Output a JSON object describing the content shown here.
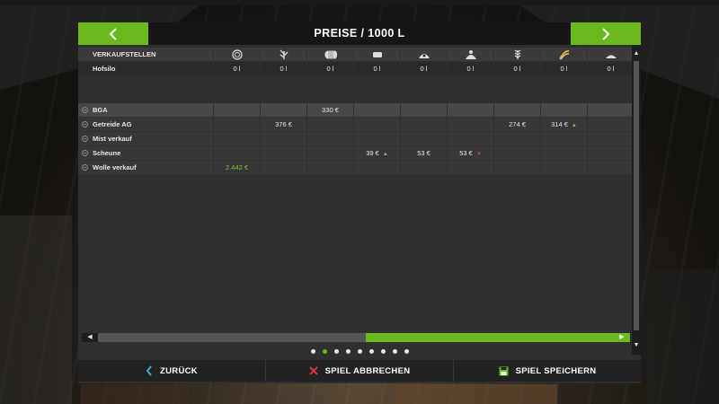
{
  "header": {
    "title": "PREISE / 1000 L"
  },
  "table": {
    "header_label": "VERKAUFSTELLEN",
    "product_icons": [
      "wool-icon",
      "grass-icon",
      "bale-icon",
      "block-icon",
      "heap-icon",
      "sack-icon",
      "wheat-icon",
      "straw-icon",
      "pile-icon"
    ],
    "silo_label": "Hofsilo",
    "silo_values": [
      "0 l",
      "0 l",
      "0 l",
      "0 l",
      "0 l",
      "0 l",
      "0 l",
      "0 l",
      "0 l"
    ],
    "rows": [
      {
        "name": "BGA",
        "cells": [
          "",
          "",
          "330 €",
          "",
          "",
          "",
          "",
          "",
          ""
        ]
      },
      {
        "name": "Getreide AG",
        "cells": [
          "",
          "376 €",
          "",
          "",
          "",
          "",
          "274 €",
          "314 €",
          ""
        ]
      },
      {
        "name": "Mist verkauf",
        "cells": [
          "",
          "",
          "",
          "",
          "",
          "",
          "",
          "",
          ""
        ]
      },
      {
        "name": "Scheune",
        "cells": [
          "",
          "",
          "",
          "39 €",
          "53 €",
          "53 €",
          "",
          "",
          ""
        ]
      },
      {
        "name": "Wolle verkauf",
        "cells": [
          "2.442 €",
          "",
          "",
          "",
          "",
          "",
          "",
          "",
          ""
        ]
      }
    ]
  },
  "trends": [
    {
      "row": 1,
      "col": 7,
      "dir": "up"
    },
    {
      "row": 3,
      "col": 3,
      "dir": "up"
    },
    {
      "row": 3,
      "col": 5,
      "dir": "down"
    }
  ],
  "pagination": {
    "count": 9,
    "active_index": 1
  },
  "scroll": {
    "horizontal_start": 0.52,
    "horizontal_size": 0.48
  },
  "footer": {
    "back": "ZURÜCK",
    "quit": "SPIEL ABBRECHEN",
    "save": "SPIEL SPEICHERN"
  },
  "colors": {
    "accent": "#6aba1e",
    "price_highlight": "#79c540",
    "trend_up": "#79c540",
    "trend_down": "#d43a3a"
  }
}
